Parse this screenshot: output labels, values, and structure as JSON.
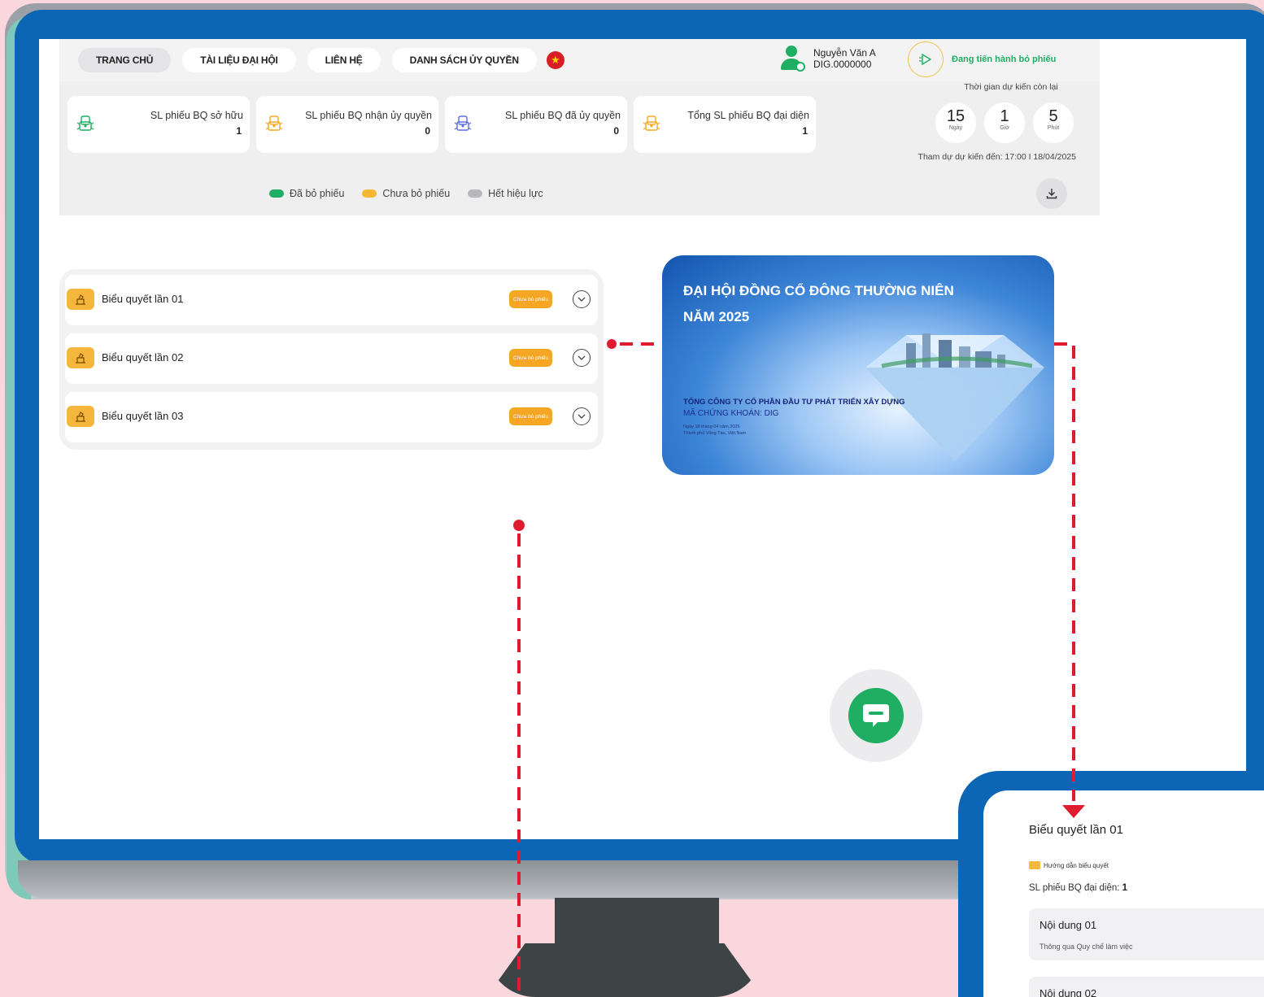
{
  "nav": {
    "tabs": [
      {
        "label": "TRANG CHỦ",
        "active": true
      },
      {
        "label": "TÀI LIỆU ĐẠI HỘI",
        "active": false
      },
      {
        "label": "LIÊN HỆ",
        "active": false
      },
      {
        "label": "DANH SÁCH ỦY QUYỀN",
        "active": false
      }
    ],
    "flag_icon": "vietnam-flag-icon"
  },
  "user": {
    "name": "Nguyễn Văn A",
    "id": "DIG.0000000"
  },
  "vote_status": {
    "label": "Đang tiến hành bỏ phiếu",
    "icon": "play-icon",
    "color": "#1fae62"
  },
  "stats": [
    {
      "label": "SL phiếu BQ sở hữu",
      "value": "1",
      "icon_color": "#1fae62"
    },
    {
      "label": "SL phiếu BQ nhận ủy quyền",
      "value": "0",
      "icon_color": "#f5a623"
    },
    {
      "label": "SL phiếu BQ đã ủy quyền",
      "value": "0",
      "icon_color": "#5b6de0"
    },
    {
      "label": "Tổng SL phiếu BQ đại diện",
      "value": "1",
      "icon_color": "#f5a623"
    }
  ],
  "countdown": {
    "title": "Thời gian dự kiến còn lại",
    "days": "15",
    "days_unit": "Ngày",
    "hours": "1",
    "hours_unit": "Giờ",
    "minutes": "5",
    "minutes_unit": "Phút",
    "until": "Tham dự dự kiến đến: 17:00 I 18/04/2025"
  },
  "legend": [
    {
      "label": "Đã bỏ phiếu",
      "color": "#1fae62"
    },
    {
      "label": "Chưa bỏ phiếu",
      "color": "#f5b731"
    },
    {
      "label": "Hết hiệu lực",
      "color": "#b9b9bd"
    }
  ],
  "votes": [
    {
      "label": "Biểu quyết lần 01",
      "status": "Chưa bỏ phiếu"
    },
    {
      "label": "Biểu quyết lần 02",
      "status": "Chưa bỏ phiếu"
    },
    {
      "label": "Biểu quyết lần 03",
      "status": "Chưa bỏ phiếu"
    }
  ],
  "banner": {
    "title_line1": "ĐẠI HỘI ĐỒNG CỔ ĐÔNG THƯỜNG NIÊN",
    "title_line2": "NĂM 2025",
    "company": "TỔNG CÔNG TY CỔ PHẦN ĐẦU TƯ PHÁT TRIỂN XÂY DỰNG",
    "stock_code": "MÃ CHỨNG KHOÁN: DIG",
    "date": "Ngày 18 tháng 04 năm 2025",
    "place": "Thành phố Vũng Tàu, Việt Nam"
  },
  "detail": {
    "title": "Biểu quyết lần 01",
    "guide": "Hướng dẫn biểu quyết",
    "count_label": "SL phiếu BQ đại diện:",
    "count_value": "1",
    "contents": [
      {
        "title": "Nội dung 01",
        "desc": "Thông qua Quy chế làm việc"
      },
      {
        "title": "Nội dung 02",
        "desc": ""
      }
    ]
  },
  "colors": {
    "accent_green": "#1fae62",
    "status_orange": "#f5a623",
    "monitor_blue": "#0d66b5",
    "connector_red": "#e01b2f"
  }
}
